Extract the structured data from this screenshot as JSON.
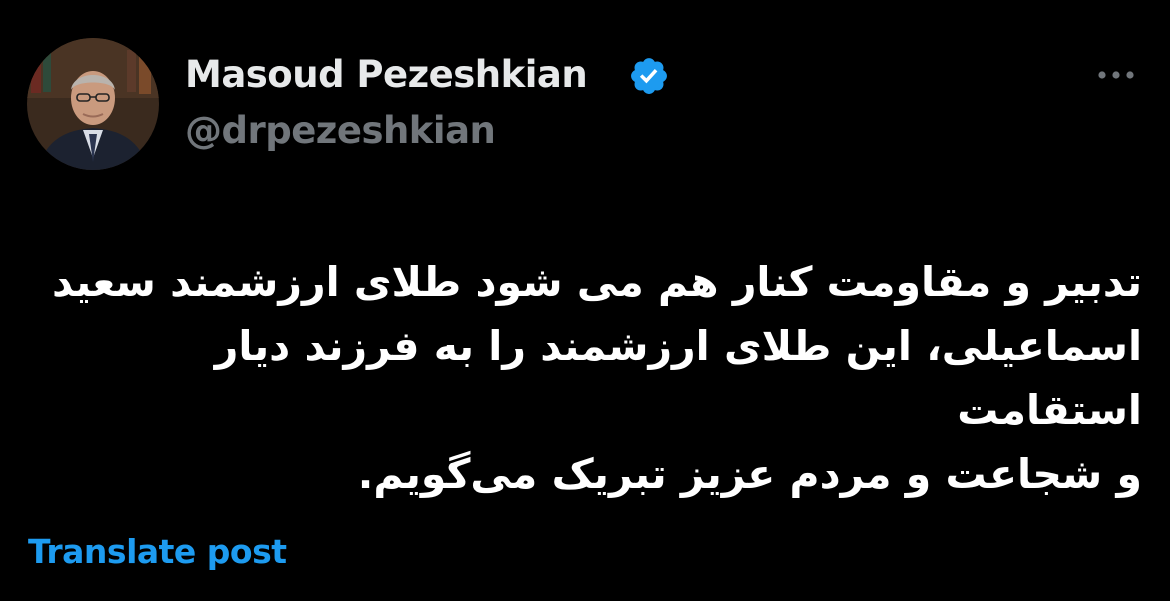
{
  "author": {
    "display_name": "Masoud Pezeshkian",
    "handle": "@drpezeshkian",
    "verified_icon": "verified-badge-icon",
    "avatar_icon": "profile-photo"
  },
  "menu": {
    "icon": "more-options-icon"
  },
  "post": {
    "lines": [
      "تدبیر و مقاومت کنار هم می شود طلای ارزشمند سعید",
      "اسماعیلی، این طلای ارزشمند را به فرزند دیار استقامت",
      "و شجاعت و مردم عزیز تبریک می‌گویم."
    ]
  },
  "actions": {
    "translate_label": "Translate post"
  },
  "colors": {
    "background": "#000000",
    "primary_text": "#e7e9ea",
    "secondary_text": "#71767b",
    "accent": "#1d9bf0"
  }
}
